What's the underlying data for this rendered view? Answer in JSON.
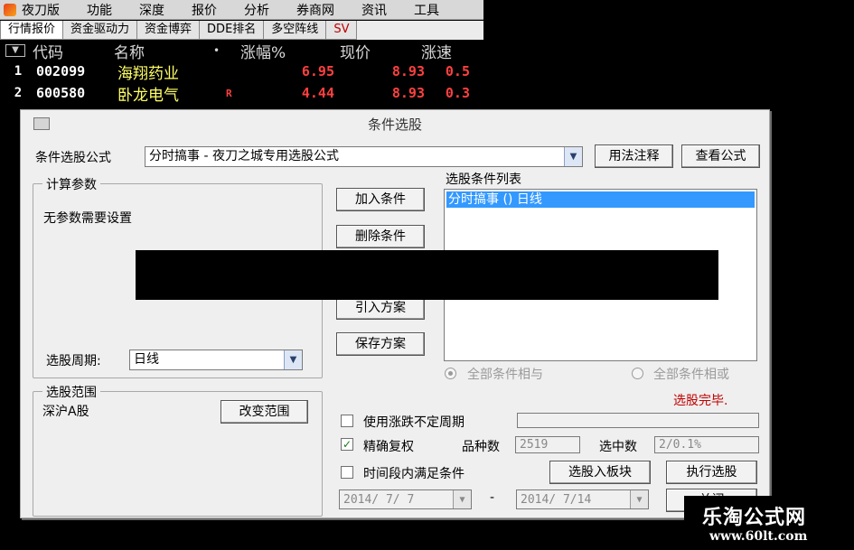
{
  "menubar": {
    "items": [
      "夜刀版",
      "功能",
      "深度",
      "报价",
      "分析",
      "券商网",
      "资讯",
      "工具"
    ]
  },
  "tabs": [
    {
      "label": "行情报价"
    },
    {
      "label": "资金驱动力"
    },
    {
      "label": "资金博弈"
    },
    {
      "label": "DDE排名"
    },
    {
      "label": "多空阵线"
    },
    {
      "label": "SV"
    }
  ],
  "quote_table": {
    "headers": {
      "code": "代码",
      "name": "名称",
      "dot": "•",
      "chg": "涨幅%",
      "price": "现价",
      "more": "涨速"
    },
    "rows": [
      {
        "idx": "1",
        "code": "002099",
        "name": "海翔药业",
        "flag": "",
        "chg": "6.95",
        "price": "8.93",
        "more": "0.5"
      },
      {
        "idx": "2",
        "code": "600580",
        "name": "卧龙电气",
        "flag": "R",
        "chg": "4.44",
        "price": "8.93",
        "more": "0.3"
      }
    ]
  },
  "dialog": {
    "title": "条件选股",
    "formula_label": "条件选股公式",
    "formula_value": "分时搞事  - 夜刀之城专用选股公式",
    "usage_button": "用法注释",
    "view_button": "查看公式",
    "params_group": "计算参数",
    "params_text": "无参数需要设置",
    "add_button": "加入条件",
    "delete_button": "删除条件",
    "import_button": "引入方案",
    "save_button": "保存方案",
    "list_label": "选股条件列表",
    "list_items": [
      "分时搞事  ()  日线"
    ],
    "radio_and": "全部条件相与",
    "radio_or": "全部条件相或",
    "status": "选股完毕.",
    "period_label": "选股周期:",
    "period_value": "日线",
    "range_group": "选股范围",
    "range_value": "深沪A股",
    "change_range_button": "改变范围",
    "use_flex_label": "使用涨跌不定周期",
    "exact_label": "精确复权",
    "count_label": "品种数",
    "count_value": "2519",
    "selected_label": "选中数",
    "selected_value": "2/0.1%",
    "timespan_label": "时间段内满足条件",
    "select_to_block_button": "选股入板块",
    "execute_button": "执行选股",
    "start_date": "2014/ 7/ 7",
    "end_date": "2014/ 7/14",
    "dash": "-",
    "close_button": "关闭"
  },
  "watermark": {
    "title": "乐淘公式网",
    "url": "www.60lt.com"
  }
}
